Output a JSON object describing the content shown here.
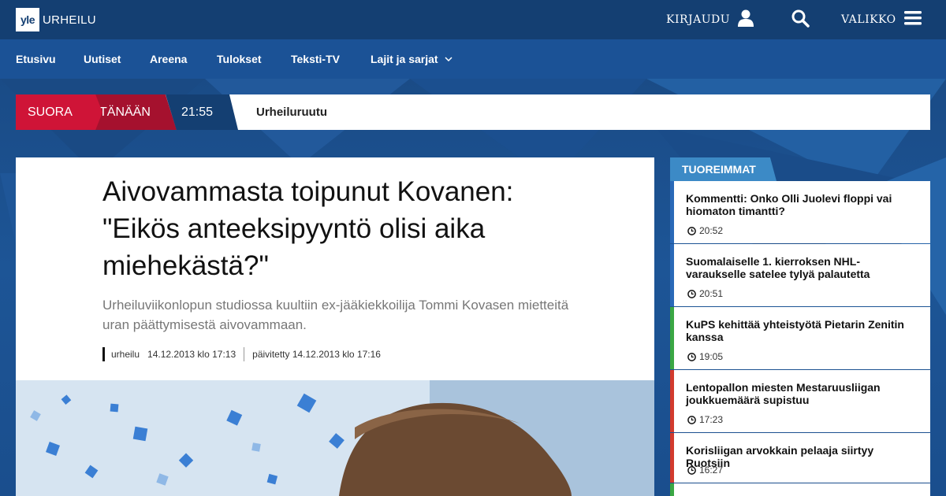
{
  "header": {
    "logo_mark": "yle",
    "logo_text": "URHEILU",
    "login_label": "KIRJAUDU",
    "menu_label": "VALIKKO",
    "icons": [
      "user-icon",
      "search-icon",
      "hamburger-menu-icon"
    ]
  },
  "nav": {
    "items": [
      "Etusivu",
      "Uutiset",
      "Areena",
      "Tulokset",
      "Teksti-TV",
      "Lajit ja sarjat"
    ]
  },
  "live": {
    "suora": "SUORA",
    "tanaan": "TÄNÄÄN",
    "time": "21:55",
    "title": "Urheiluruutu"
  },
  "article": {
    "headline": "Aivovammasta toipunut Kovanen: \"Eikös anteeksipyyntö olisi aika miehekästä?\"",
    "lede": "Urheiluviikonlopun studiossa kuultiin ex-jääkiekkoilija Tommi Kovasen mietteitä uran päättymisestä aivovammaan.",
    "category": "urheilu",
    "published": "14.12.2013 klo 17:13",
    "updated": "päivitetty 14.12.2013 klo 17:16"
  },
  "sidebar": {
    "tab_label": "TUOREIMMAT",
    "items": [
      {
        "title": "Kommentti: Onko Olli Juolevi floppi vai hiomaton timantti?",
        "time": "20:52",
        "color": "#2a69b8"
      },
      {
        "title": "Suomalaiselle 1. kierroksen NHL-varaukselle satelee tylyä palautetta",
        "time": "20:51",
        "color": "#2a69b8"
      },
      {
        "title": "KuPS kehittää yhteistyötä Pietarin Zenitin kanssa",
        "time": "19:05",
        "color": "#3aa744"
      },
      {
        "title": "Lentopallon miesten Mestaruusliigan joukkuemäärä supistuu",
        "time": "17:23",
        "color": "#d23a2d"
      },
      {
        "title": "Korisliigan arvokkain pelaaja siirtyy Ruotsiin",
        "time": "16:27",
        "color": "#d23a2d"
      }
    ]
  },
  "colors": {
    "header_bg": "#143f72",
    "nav_bg": "#1b5296",
    "live_red": "#cf1437",
    "live_dark_red": "#a5112e",
    "tab_blue": "#3c8ac6"
  }
}
